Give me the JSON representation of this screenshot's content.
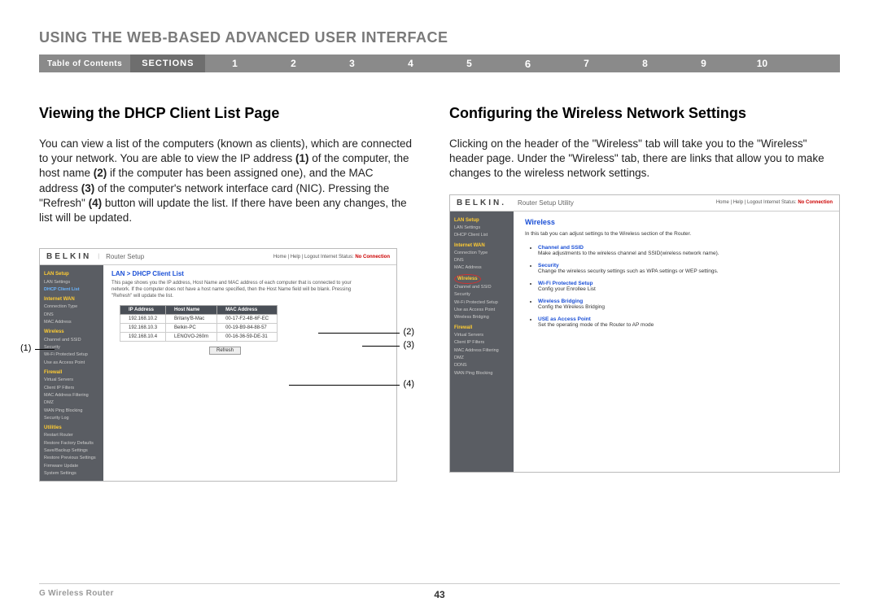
{
  "header": {
    "title": "USING THE WEB-BASED ADVANCED USER INTERFACE",
    "toc": "Table of Contents",
    "sections": "SECTIONS"
  },
  "nav_numbers": [
    "1",
    "2",
    "3",
    "4",
    "5",
    "6",
    "7",
    "8",
    "9",
    "10"
  ],
  "nav_active": "6",
  "left": {
    "heading": "Viewing the DHCP Client List Page",
    "para_parts": {
      "p0": "You can view a list of the computers (known as clients), which are connected to your network. You are able to view the IP address ",
      "b1": "(1)",
      "p1": " of the computer, the host name ",
      "b2": "(2)",
      "p2": " if the computer has been assigned one), and the MAC address ",
      "b3": "(3)",
      "p3": " of the computer's network interface card (NIC). Pressing the \"Refresh\" ",
      "b4": "(4)",
      "p4": " button will update the list. If there have been any changes, the list will be updated."
    },
    "shot": {
      "brand": "BELKIN",
      "sub": "Router Setup",
      "links": "Home | Help | Logout   Internet Status:",
      "noconn": " No Connection",
      "breadcrumb": "LAN > DHCP Client List",
      "desc": "This page shows you the IP address, Host Name and MAC address of each computer that is connected to your network. If the computer does not have a host name specified, then the Host Name field will be blank. Pressing \"Refresh\" will update the list.",
      "th": {
        "ip": "IP Address",
        "host": "Host Name",
        "mac": "MAC Address"
      },
      "rows": [
        {
          "ip": "192.168.10.2",
          "host": "Britany'B-Mac",
          "mac": "00-17-F2-4B-6F-EC"
        },
        {
          "ip": "192.168.10.3",
          "host": "Belkin-PC",
          "mac": "00-19-B9-84-88-57"
        },
        {
          "ip": "192.168.10.4",
          "host": "LENOVO-260m",
          "mac": "00-16-36-59-DE-31"
        }
      ],
      "refresh": "Refresh",
      "sidebar": {
        "lan_setup": "LAN Setup",
        "lan_settings": "LAN Settings",
        "dhcp": "DHCP Client List",
        "internet_wan": "Internet WAN",
        "conn": "Connection Type",
        "dns": "DNS",
        "mac": "MAC Address",
        "wireless": "Wireless",
        "chssid": "Channel and SSID",
        "sec": "Security",
        "wps": "Wi-Fi Protected Setup",
        "uap": "Use as Access Point",
        "firewall": "Firewall",
        "vs": "Virtual Servers",
        "cip": "Client IP Filters",
        "macf": "MAC Address Filtering",
        "dmz": "DMZ",
        "wpb": "WAN Ping Blocking",
        "slog": "Security Log",
        "utilities": "Utilities",
        "rr": "Restart Router",
        "rfd": "Restore Factory Defaults",
        "sbs": "Save/Backup Settings",
        "rps": "Restore Previous Settings",
        "fu": "Firmware Update",
        "ss": "System Settings"
      }
    },
    "callouts": {
      "c1": "(1)",
      "c2": "(2)",
      "c3": "(3)",
      "c4": "(4)"
    }
  },
  "right": {
    "heading": "Configuring the Wireless Network Settings",
    "para": "Clicking on the header of the \"Wireless\" tab will take you to the \"Wireless\" header page. Under the \"Wireless\" tab, there are links that allow you to make changes to the wireless network settings.",
    "shot": {
      "brand": "BELKIN.",
      "sub": "Router Setup Utility",
      "links": "Home | Help | Logout   Internet Status:",
      "noconn": " No Connection",
      "breadcrumb": "Wireless",
      "desc": "In this tab you can adjust settings to the Wireless section of the Router.",
      "items": [
        {
          "lk": "Channel and SSID",
          "sub": "Make adjustments to the wireless channel and SSID(wireless network name)."
        },
        {
          "lk": "Security",
          "sub": "Change the wireless security settings such as WPA settings or WEP settings."
        },
        {
          "lk": "Wi-Fi Protected Setup",
          "sub": "Config your Enrollee List"
        },
        {
          "lk": "Wireless Bridging",
          "sub": "Config the Wireless Bridging"
        },
        {
          "lk": "USE as Access Point",
          "sub": "Set the operating mode of the Router to AP mode"
        }
      ],
      "sidebar": {
        "lan_setup": "LAN Setup",
        "lan_settings": "LAN Settings",
        "dhcp": "DHCP Client List",
        "internet_wan": "Internet WAN",
        "conn": "Connection Type",
        "dns": "DNS",
        "mac": "MAC Address",
        "wireless": "Wireless",
        "chssid": "Channel and SSID",
        "sec": "Security",
        "wps": "Wi-Fi Protected Setup",
        "uap": "Use as Access Point",
        "wb": "Wireless Bridging",
        "firewall": "Firewall",
        "vs": "Virtual Servers",
        "cip": "Client IP Filters",
        "macf": "MAC Address Filtering",
        "dmz": "DMZ",
        "ddns": "DDNS",
        "wpb": "WAN Ping Blocking"
      }
    }
  },
  "footer": {
    "left": "G Wireless Router",
    "center": "43"
  }
}
